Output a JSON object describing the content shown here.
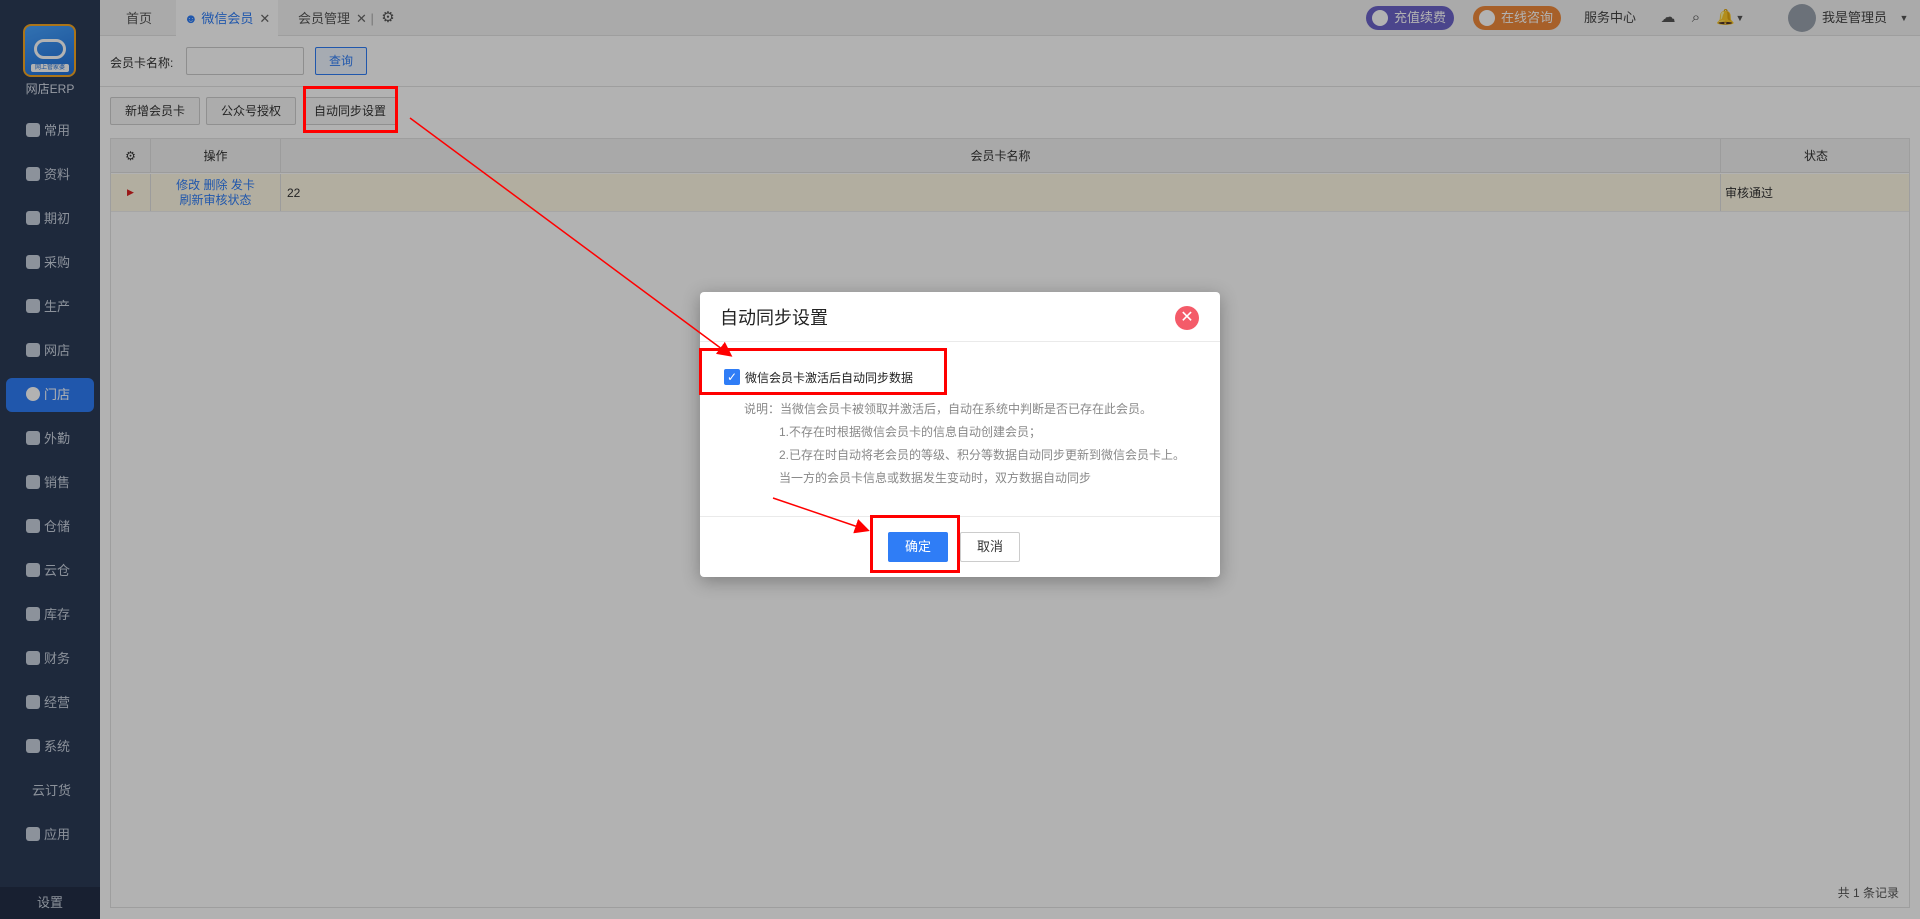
{
  "sidebar": {
    "brand": "网店ERP",
    "logo_text": "网上管家婆",
    "items": [
      {
        "label": "常用",
        "icon": "star-icon"
      },
      {
        "label": "资料",
        "icon": "document-icon"
      },
      {
        "label": "期初",
        "icon": "refresh-icon"
      },
      {
        "label": "采购",
        "icon": "purchase-icon"
      },
      {
        "label": "生产",
        "icon": "production-icon"
      },
      {
        "label": "网店",
        "icon": "shop-icon"
      },
      {
        "label": "门店",
        "icon": "store-icon"
      },
      {
        "label": "外勤",
        "icon": "field-icon"
      },
      {
        "label": "销售",
        "icon": "sales-icon"
      },
      {
        "label": "仓储",
        "icon": "warehouse-icon"
      },
      {
        "label": "云仓",
        "icon": "cloud-warehouse-icon"
      },
      {
        "label": "库存",
        "icon": "inventory-icon"
      },
      {
        "label": "财务",
        "icon": "finance-icon"
      },
      {
        "label": "经营",
        "icon": "operation-icon"
      },
      {
        "label": "系统",
        "icon": "system-icon"
      },
      {
        "label": "云订货",
        "icon": ""
      },
      {
        "label": "应用",
        "icon": "app-icon"
      }
    ],
    "active": "门店",
    "settings": "设置"
  },
  "topbar": {
    "tabs": [
      {
        "label": "首页"
      },
      {
        "label": "微信会员"
      },
      {
        "label": "会员管理"
      }
    ],
    "recharge": "充值续费",
    "consult": "在线咨询",
    "service": "服务中心",
    "user": "我是管理员"
  },
  "search": {
    "label": "会员卡名称:",
    "value": "",
    "query_button": "查询"
  },
  "toolbar": {
    "add": "新增会员卡",
    "auth": "公众号授权",
    "autosync": "自动同步设置"
  },
  "grid": {
    "headers": [
      "操作",
      "会员卡名称",
      "状态"
    ],
    "rows": [
      {
        "actions": [
          "修改",
          "删除",
          "发卡",
          "刷新审核状态"
        ],
        "name": "22",
        "status": "审核通过"
      }
    ],
    "pager": "共 1 条记录"
  },
  "dialog": {
    "title": "自动同步设置",
    "checkbox_label": "微信会员卡激活后自动同步数据",
    "checked": true,
    "desc": [
      "说明：当微信会员卡被领取并激活后，自动在系统中判断是否已存在此会员。",
      "1.不存在时根据微信会员卡的信息自动创建会员；",
      "2.已存在时自动将老会员的等级、积分等数据自动同步更新到微信会员卡上。",
      "当一方的会员卡信息或数据发生变动时，双方数据自动同步"
    ],
    "ok": "确定",
    "cancel": "取消"
  },
  "colors": {
    "accent": "#2f7df6",
    "sidebar_bg": "#2c3b57",
    "recharge": "#6c63c9",
    "consult": "#ef8a3c",
    "close": "#f45b69",
    "highlight": "#ff0000"
  }
}
